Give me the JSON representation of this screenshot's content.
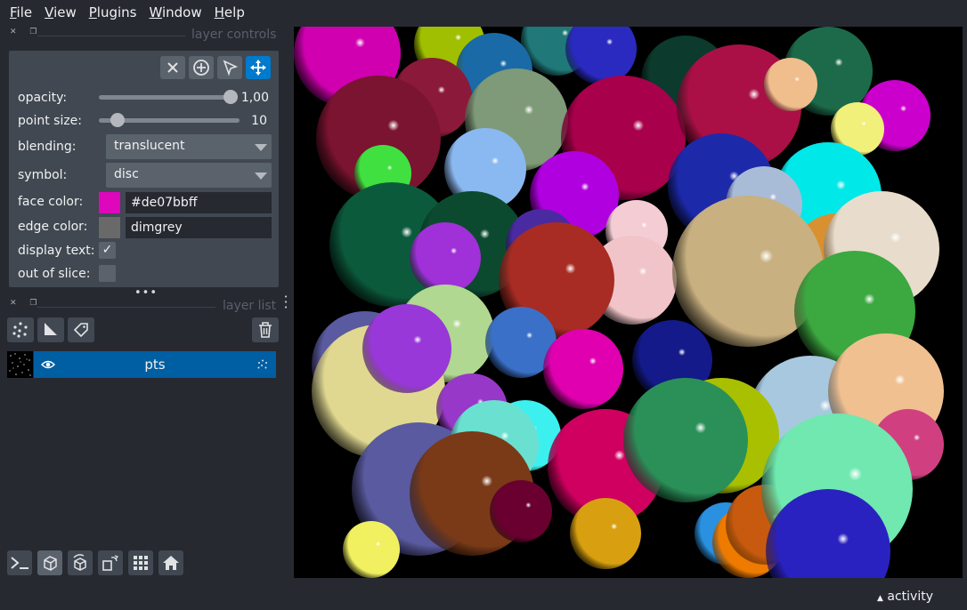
{
  "menu": [
    {
      "label": "File",
      "underline": "F",
      "rest": "ile"
    },
    {
      "label": "View",
      "underline": "V",
      "rest": "iew"
    },
    {
      "label": "Plugins",
      "underline": "P",
      "rest": "lugins"
    },
    {
      "label": "Window",
      "underline": "W",
      "rest": "indow"
    },
    {
      "label": "Help",
      "underline": "H",
      "rest": "elp"
    }
  ],
  "layer_controls": {
    "title": "layer controls",
    "opacity": {
      "label": "opacity:",
      "value": "1,00",
      "fraction": 1.0
    },
    "point_size": {
      "label": "point size:",
      "value": "10",
      "fraction": 0.13
    },
    "blending": {
      "label": "blending:",
      "value": "translucent"
    },
    "symbol": {
      "label": "symbol:",
      "value": "disc"
    },
    "face_color": {
      "label": "face color:",
      "value": "#de07bbff",
      "swatch": "#de07bb"
    },
    "edge_color": {
      "label": "edge color:",
      "value": "dimgrey",
      "swatch": "#696969"
    },
    "display_text": {
      "label": "display text:",
      "checked": true
    },
    "out_of_slice": {
      "label": "out of slice:",
      "checked": false
    }
  },
  "layer_list": {
    "title": "layer list",
    "layers": [
      {
        "name": "pts",
        "visible": true,
        "selected": true
      }
    ]
  },
  "status": {
    "activity": "activity"
  },
  "colors": {
    "accent": "#007acc",
    "selected_layer": "#005fa3",
    "background": "#262930",
    "panel": "#414851"
  }
}
